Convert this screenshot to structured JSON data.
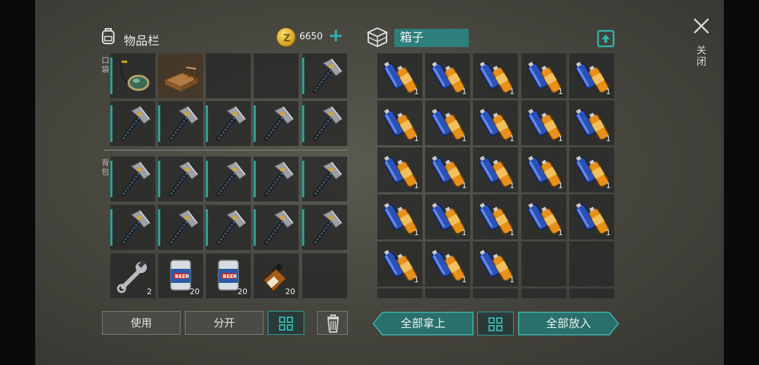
{
  "inventory": {
    "title": "物品栏",
    "coins": "6650",
    "pocket_label": "口袋",
    "backpack_label": "背包",
    "pocket_rows": [
      [
        {
          "item": "goggles"
        },
        {
          "item": "workbench"
        },
        {
          "item": "empty"
        },
        {
          "item": "empty"
        },
        {
          "item": "hatchet"
        }
      ],
      [
        {
          "item": "hatchet"
        },
        {
          "item": "hatchet"
        },
        {
          "item": "hatchet"
        },
        {
          "item": "hatchet"
        },
        {
          "item": "hatchet"
        }
      ]
    ],
    "backpack_rows": [
      [
        {
          "item": "hatchet"
        },
        {
          "item": "hatchet"
        },
        {
          "item": "hatchet"
        },
        {
          "item": "hatchet"
        },
        {
          "item": "hatchet"
        }
      ],
      [
        {
          "item": "hatchet"
        },
        {
          "item": "hatchet"
        },
        {
          "item": "hatchet"
        },
        {
          "item": "hatchet"
        },
        {
          "item": "hatchet"
        }
      ],
      [
        {
          "item": "wrench",
          "qty": "2"
        },
        {
          "item": "beer",
          "qty": "20"
        },
        {
          "item": "beer",
          "qty": "20"
        },
        {
          "item": "whiskey",
          "qty": "20"
        },
        {
          "item": "empty"
        }
      ]
    ],
    "buttons": {
      "use": "使用",
      "split": "分开"
    }
  },
  "container": {
    "title": "箱子",
    "battery_qty": "1",
    "battery_count": 23,
    "buttons": {
      "take_all": "全部拿上",
      "put_all": "全部放入"
    }
  },
  "close_label": "关闭",
  "icons": {
    "inventory": "backpack-icon",
    "coin": "coin-icon",
    "plus": "plus-icon",
    "box": "box-icon",
    "upload": "upload-icon",
    "close": "close-icon",
    "grid": "grid-icon",
    "trash": "trash-icon"
  },
  "colors": {
    "accent": "#2aa29a",
    "title_bg": "#2d7f7b",
    "slot_bg": "#262828"
  }
}
